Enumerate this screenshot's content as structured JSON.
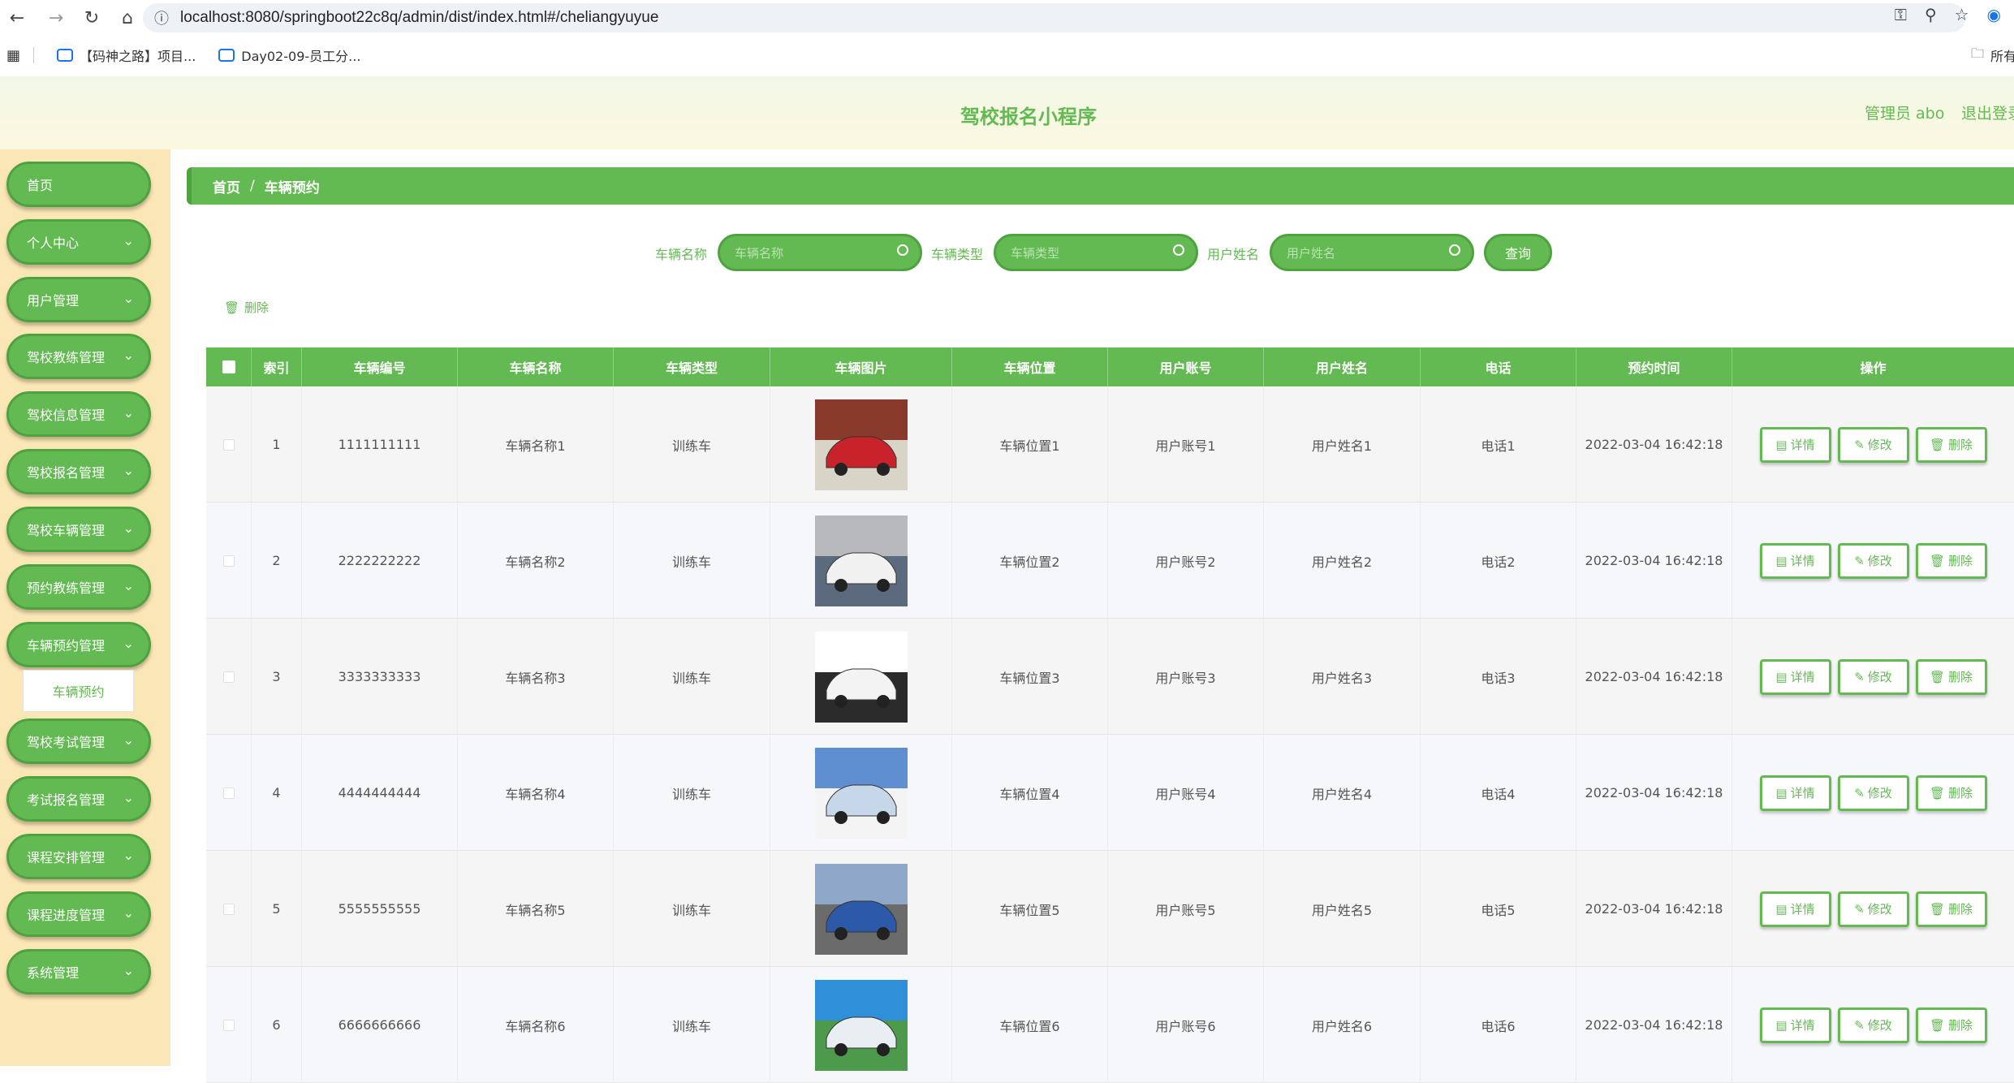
{
  "browser": {
    "url": "localhost:8080/springboot22c8q/admin/dist/index.html#/cheliangyuyue",
    "bookmarks": [
      "【码神之路】项目...",
      "Day02-09-员工分...",
      "所有"
    ]
  },
  "header": {
    "title": "驾校报名小程序",
    "user": "管理员 abo",
    "logout": "退出登录"
  },
  "sidebar": {
    "items": [
      {
        "label": "首页",
        "has_arrow": false
      },
      {
        "label": "个人中心",
        "has_arrow": true
      },
      {
        "label": "用户管理",
        "has_arrow": true
      },
      {
        "label": "驾校教练管理",
        "has_arrow": true
      },
      {
        "label": "驾校信息管理",
        "has_arrow": true
      },
      {
        "label": "驾校报名管理",
        "has_arrow": true
      },
      {
        "label": "驾校车辆管理",
        "has_arrow": true
      },
      {
        "label": "预约教练管理",
        "has_arrow": true
      },
      {
        "label": "车辆预约管理",
        "has_arrow": true
      },
      {
        "label": "驾校考试管理",
        "has_arrow": true
      },
      {
        "label": "考试报名管理",
        "has_arrow": true
      },
      {
        "label": "课程安排管理",
        "has_arrow": true
      },
      {
        "label": "课程进度管理",
        "has_arrow": true
      },
      {
        "label": "系统管理",
        "has_arrow": true
      }
    ],
    "submenu_active": "车辆预约"
  },
  "breadcrumb": {
    "home": "首页",
    "sep": "/",
    "current": "车辆预约"
  },
  "search": {
    "car_name_label": "车辆名称",
    "car_name_placeholder": "车辆名称",
    "car_type_label": "车辆类型",
    "car_type_placeholder": "车辆类型",
    "user_name_label": "用户姓名",
    "user_name_placeholder": "用户姓名",
    "query_label": "查询"
  },
  "toolbar": {
    "delete_label": "删除"
  },
  "table": {
    "headers": [
      "索引",
      "车辆编号",
      "车辆名称",
      "车辆类型",
      "车辆图片",
      "车辆位置",
      "用户账号",
      "用户姓名",
      "电话",
      "预约时间",
      "操作"
    ],
    "rows": [
      {
        "index": "1",
        "code": "1111111111",
        "name": "车辆名称1",
        "type": "训练车",
        "location": "车辆位置1",
        "account": "用户账号1",
        "username": "用户姓名1",
        "phone": "电话1",
        "time": "2022-03-04 16:42:18"
      },
      {
        "index": "2",
        "code": "2222222222",
        "name": "车辆名称2",
        "type": "训练车",
        "location": "车辆位置2",
        "account": "用户账号2",
        "username": "用户姓名2",
        "phone": "电话2",
        "time": "2022-03-04 16:42:18"
      },
      {
        "index": "3",
        "code": "3333333333",
        "name": "车辆名称3",
        "type": "训练车",
        "location": "车辆位置3",
        "account": "用户账号3",
        "username": "用户姓名3",
        "phone": "电话3",
        "time": "2022-03-04 16:42:18"
      },
      {
        "index": "4",
        "code": "4444444444",
        "name": "车辆名称4",
        "type": "训练车",
        "location": "车辆位置4",
        "account": "用户账号4",
        "username": "用户姓名4",
        "phone": "电话4",
        "time": "2022-03-04 16:42:18"
      },
      {
        "index": "5",
        "code": "5555555555",
        "name": "车辆名称5",
        "type": "训练车",
        "location": "车辆位置5",
        "account": "用户账号5",
        "username": "用户姓名5",
        "phone": "电话5",
        "time": "2022-03-04 16:42:18"
      },
      {
        "index": "6",
        "code": "6666666666",
        "name": "车辆名称6",
        "type": "训练车",
        "location": "车辆位置6",
        "account": "用户账号6",
        "username": "用户姓名6",
        "phone": "电话6",
        "time": "2022-03-04 16:42:18"
      }
    ],
    "actions": {
      "detail": "详情",
      "edit": "修改",
      "delete": "删除"
    }
  },
  "colors": {
    "accent": "#63ba52",
    "accent_dark": "#4fa33e",
    "sidebar_bg": "#fbe6b5"
  }
}
